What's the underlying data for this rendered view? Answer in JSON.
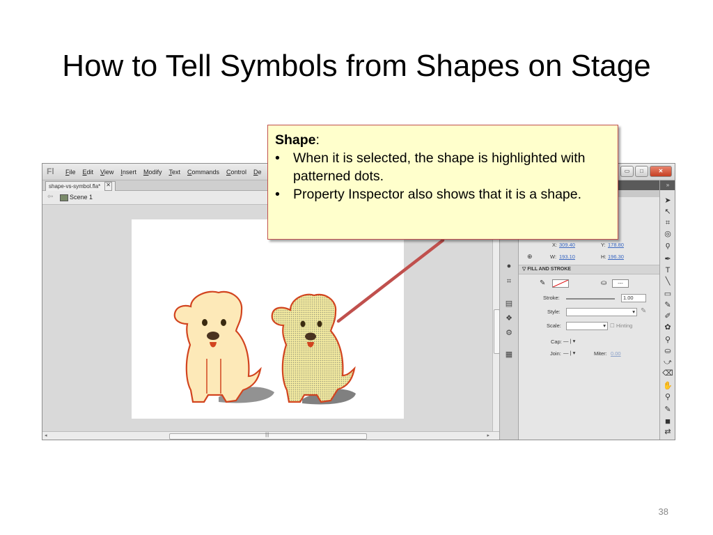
{
  "slide": {
    "title": "How to Tell Symbols from Shapes on Stage",
    "number": "38"
  },
  "app": {
    "logo": "Fl",
    "menu": [
      "File",
      "Edit",
      "View",
      "Insert",
      "Modify",
      "Text",
      "Commands",
      "Control",
      "De"
    ],
    "window_buttons": [
      "minimize-icon",
      "maximize-icon",
      "close-icon"
    ],
    "doc_tab": {
      "label": "shape-vs-symbol.fla*",
      "close": "✕"
    },
    "scene_label": "Scene 1"
  },
  "properties": {
    "position": {
      "x_label": "X:",
      "x_value": "309.40",
      "y_label": "Y:",
      "y_value": "178.80"
    },
    "size": {
      "w_label": "W:",
      "w_value": "193.10",
      "h_label": "H:",
      "h_value": "196.30"
    },
    "fill_stroke_header": "FILL AND STROKE",
    "stroke_label": "Stroke:",
    "stroke_value": "1.00",
    "style_label": "Style:",
    "scale_label": "Scale:",
    "hinting_label": "Hinting",
    "cap_label": "Cap:",
    "join_label": "Join:",
    "miter_label": "Miter:",
    "miter_value": "0.00",
    "swatch_text": "---"
  },
  "colors": {
    "callout_bg": "#ffffcc",
    "callout_border": "#c0504d",
    "pointer": "#c0504d",
    "dog_fill": "#fde9b8",
    "dog_stroke": "#d2441f"
  },
  "callout": {
    "heading": "Shape",
    "heading_suffix": ":",
    "bullets": [
      "When it is selected, the shape is highlighted with patterned dots.",
      "Property Inspector also shows that it is a shape."
    ]
  }
}
